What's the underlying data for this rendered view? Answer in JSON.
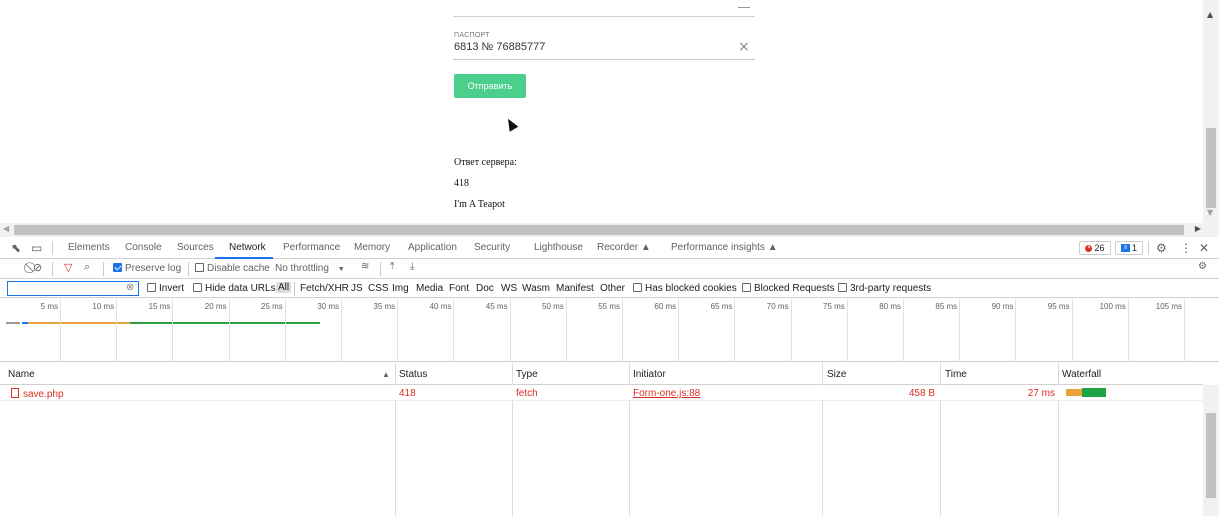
{
  "form": {
    "passport_label": "ПАСПОРТ",
    "passport_value": "6813 № 76885777",
    "submit_label": "Отправить",
    "response_heading": "Ответ сервера:",
    "response_code": "418",
    "response_text": "I'm A Teapot"
  },
  "devtools": {
    "tabs": [
      "Elements",
      "Console",
      "Sources",
      "Network",
      "Performance",
      "Memory",
      "Application",
      "Security",
      "Lighthouse",
      "Recorder ▲",
      "Performance insights ▲"
    ],
    "active_tab": "Network",
    "error_count": "26",
    "message_count": "1",
    "toolbar": {
      "preserve_log": "Preserve log",
      "disable_cache": "Disable cache",
      "throttling": "No throttling"
    },
    "filter": {
      "placeholder": "",
      "invert": "Invert",
      "hide_data_urls": "Hide data URLs",
      "types": [
        "All",
        "Fetch/XHR",
        "JS",
        "CSS",
        "Img",
        "Media",
        "Font",
        "Doc",
        "WS",
        "Wasm",
        "Manifest",
        "Other"
      ],
      "has_blocked_cookies": "Has blocked cookies",
      "blocked_requests": "Blocked Requests",
      "third_party": "3rd-party requests"
    },
    "timeline_ticks": [
      "5 ms",
      "10 ms",
      "15 ms",
      "20 ms",
      "25 ms",
      "30 ms",
      "35 ms",
      "40 ms",
      "45 ms",
      "50 ms",
      "55 ms",
      "60 ms",
      "65 ms",
      "70 ms",
      "75 ms",
      "80 ms",
      "85 ms",
      "90 ms",
      "95 ms",
      "100 ms",
      "105 ms"
    ],
    "columns": [
      "Name",
      "Status",
      "Type",
      "Initiator",
      "Size",
      "Time",
      "Waterfall"
    ],
    "rows": [
      {
        "name": "save.php",
        "status": "418",
        "type": "fetch",
        "initiator": "Form-one.js:88",
        "size": "458 B",
        "time": "27 ms"
      }
    ],
    "colors": {
      "accent": "#1a73e8",
      "error": "#d93025",
      "submit": "#4ccf8c"
    }
  }
}
